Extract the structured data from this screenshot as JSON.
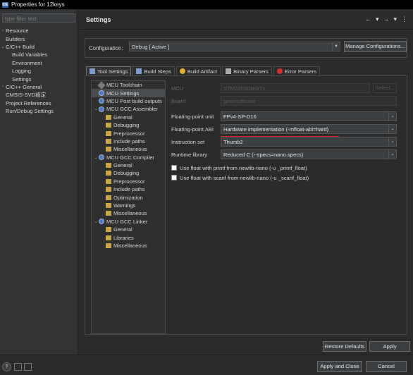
{
  "window": {
    "title": "Properties for 12keys",
    "app_icon": "IDE"
  },
  "sidebar": {
    "filter_placeholder": "type filter text",
    "items": [
      {
        "label": "Resource",
        "expand": "›"
      },
      {
        "label": "Builders",
        "expand": ""
      },
      {
        "label": "C/C++ Build",
        "expand": "⌄"
      },
      {
        "label": "Build Variables",
        "expand": ""
      },
      {
        "label": "Environment",
        "expand": ""
      },
      {
        "label": "Logging",
        "expand": ""
      },
      {
        "label": "Settings",
        "expand": ""
      },
      {
        "label": "C/C++ General",
        "expand": "›"
      },
      {
        "label": "CMSIS-SVD設定",
        "expand": ""
      },
      {
        "label": "Project References",
        "expand": ""
      },
      {
        "label": "Run/Debug Settings",
        "expand": ""
      }
    ]
  },
  "header": {
    "title": "Settings",
    "nav": [
      "←",
      "▾",
      "→",
      "▾",
      "⋮"
    ]
  },
  "configuration": {
    "label": "Configuration:",
    "value": "Debug  [ Active ]",
    "manage_label": "Manage Configurations..."
  },
  "tabs": [
    {
      "label": "Tool Settings",
      "icon_color": "#7a9cc6"
    },
    {
      "label": "Build Steps",
      "icon_color": "#7a9cc6"
    },
    {
      "label": "Build Artifact",
      "icon_color": "#e0b030"
    },
    {
      "label": "Binary Parsers",
      "icon_color": "#aaaaaa"
    },
    {
      "label": "Error Parsers",
      "icon_color": "#d03030"
    }
  ],
  "tool_tree": [
    {
      "label": "MCU Toolchain",
      "icon": "tool-icon"
    },
    {
      "label": "MCU Settings",
      "icon": "gear-icon"
    },
    {
      "label": "MCU Post build outputs",
      "icon": "gear-icon"
    },
    {
      "label": "MCU GCC Assembler",
      "icon": "gear-icon"
    },
    {
      "label": "General",
      "icon": "folder-icon"
    },
    {
      "label": "Debugging",
      "icon": "folder-icon"
    },
    {
      "label": "Preprocessor",
      "icon": "folder-icon"
    },
    {
      "label": "Include paths",
      "icon": "folder-icon"
    },
    {
      "label": "Miscellaneous",
      "icon": "folder-icon"
    },
    {
      "label": "MCU GCC Compiler",
      "icon": "gear-icon"
    },
    {
      "label": "General",
      "icon": "folder-icon"
    },
    {
      "label": "Debugging",
      "icon": "folder-icon"
    },
    {
      "label": "Preprocessor",
      "icon": "folder-icon"
    },
    {
      "label": "Include paths",
      "icon": "folder-icon"
    },
    {
      "label": "Optimization",
      "icon": "folder-icon"
    },
    {
      "label": "Warnings",
      "icon": "folder-icon"
    },
    {
      "label": "Miscellaneous",
      "icon": "folder-icon"
    },
    {
      "label": "MCU GCC Linker",
      "icon": "gear-icon"
    },
    {
      "label": "General",
      "icon": "folder-icon"
    },
    {
      "label": "Libraries",
      "icon": "folder-icon"
    },
    {
      "label": "Miscellaneous",
      "icon": "folder-icon"
    }
  ],
  "form": {
    "mcu": {
      "label": "MCU",
      "value": "STM32F303K8Tx",
      "button": "Select..."
    },
    "board": {
      "label": "Board",
      "value": "genericBoard"
    },
    "fpu": {
      "label": "Floating-point unit",
      "value": "FPv4-SP-D16"
    },
    "abi": {
      "label": "Floating-point ABI",
      "value": "Hardware implementation (-mfloat-abi=hard)"
    },
    "iset": {
      "label": "Instruction set",
      "value": "Thumb2"
    },
    "runtime": {
      "label": "Runtime library",
      "value": "Reduced C (--specs=nano.specs)"
    },
    "printf": {
      "label": "Use float with printf from newlib-nano (-u _printf_float)"
    },
    "scanf": {
      "label": "Use float with scanf from newlib-nano (-u _scanf_float)"
    }
  },
  "buttons": {
    "restore": "Restore Defaults",
    "apply": "Apply",
    "apply_close": "Apply and Close",
    "cancel": "Cancel",
    "help": "?"
  },
  "colors": {
    "annotation_red": "#e0201a",
    "accent_blue": "#4d7bbd"
  }
}
